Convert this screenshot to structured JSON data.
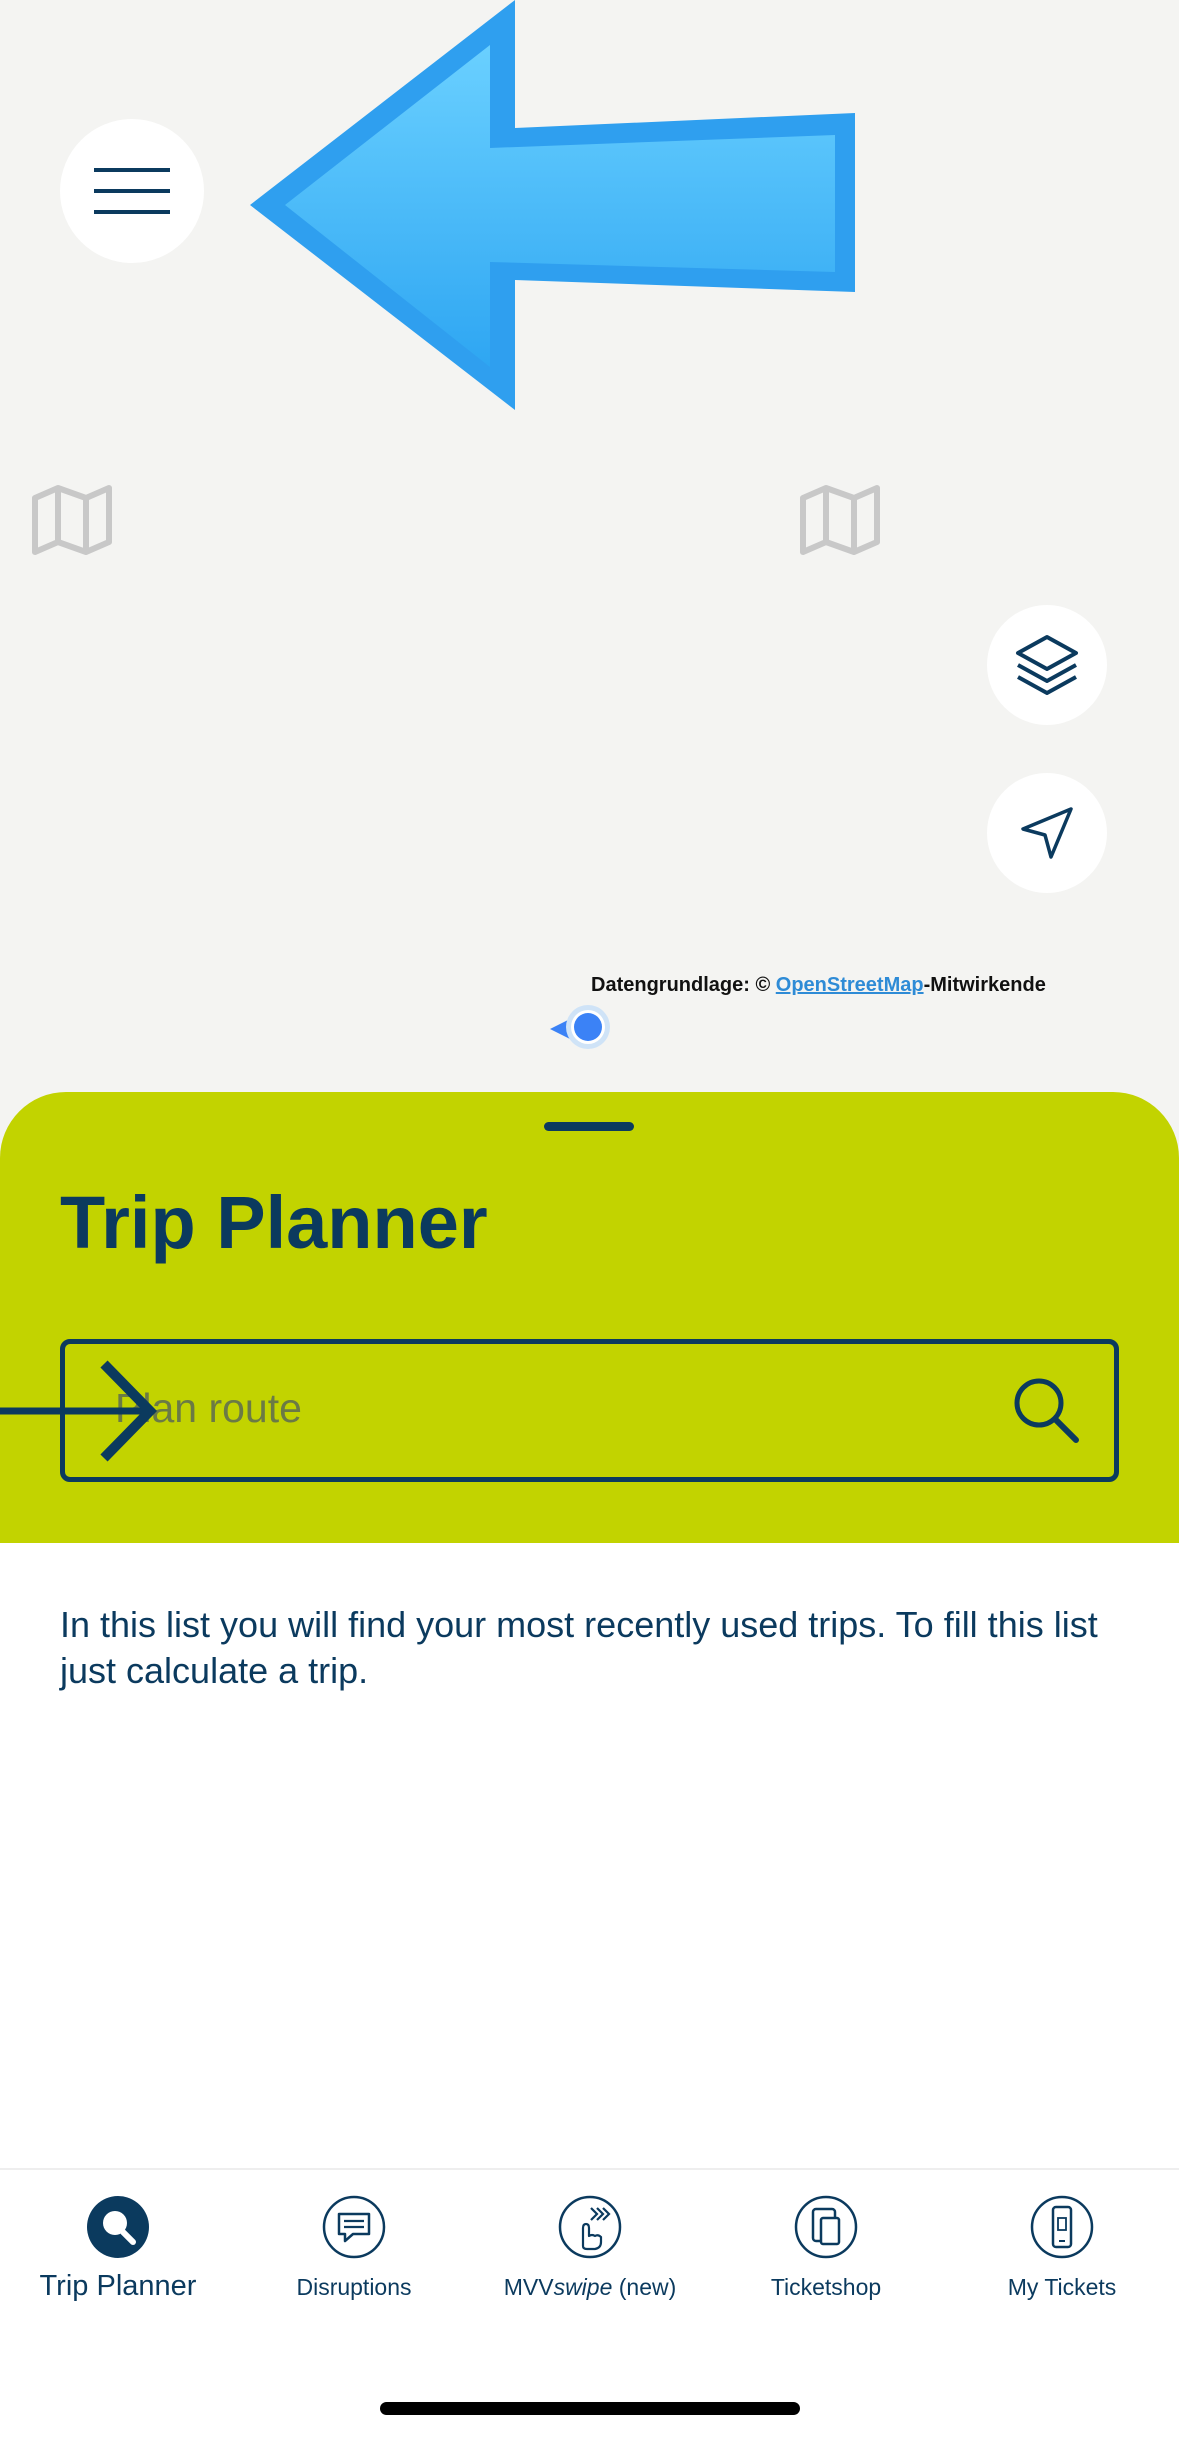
{
  "map": {
    "attribution_prefix": "Datengrundlage: ©",
    "attribution_link": "OpenStreetMap",
    "attribution_suffix": "-Mitwirkende"
  },
  "map_controls": {
    "menu_icon": "hamburger-menu-icon",
    "layers_icon": "layers-icon",
    "locate_icon": "location-arrow-icon"
  },
  "trip_planner": {
    "title": "Trip Planner",
    "search_placeholder": "Plan route",
    "info_text": "In this list you will find your most recently used trips. To fill this list just calculate a trip."
  },
  "tabs": [
    {
      "label": "Trip Planner",
      "icon": "search-icon",
      "active": true
    },
    {
      "label": "Disruptions",
      "icon": "message-icon",
      "active": false
    },
    {
      "label_prefix": "MVV",
      "label_italic": "swipe",
      "label_suffix": " (new)",
      "icon": "swipe-icon",
      "active": false
    },
    {
      "label": "Ticketshop",
      "icon": "ticketshop-icon",
      "active": false
    },
    {
      "label": "My Tickets",
      "icon": "phone-ticket-icon",
      "active": false
    }
  ],
  "colors": {
    "accent": "#c2d300",
    "navy": "#0b3a5e",
    "overlay_arrow": "#3fb6f8",
    "link": "#2e8bd6"
  }
}
